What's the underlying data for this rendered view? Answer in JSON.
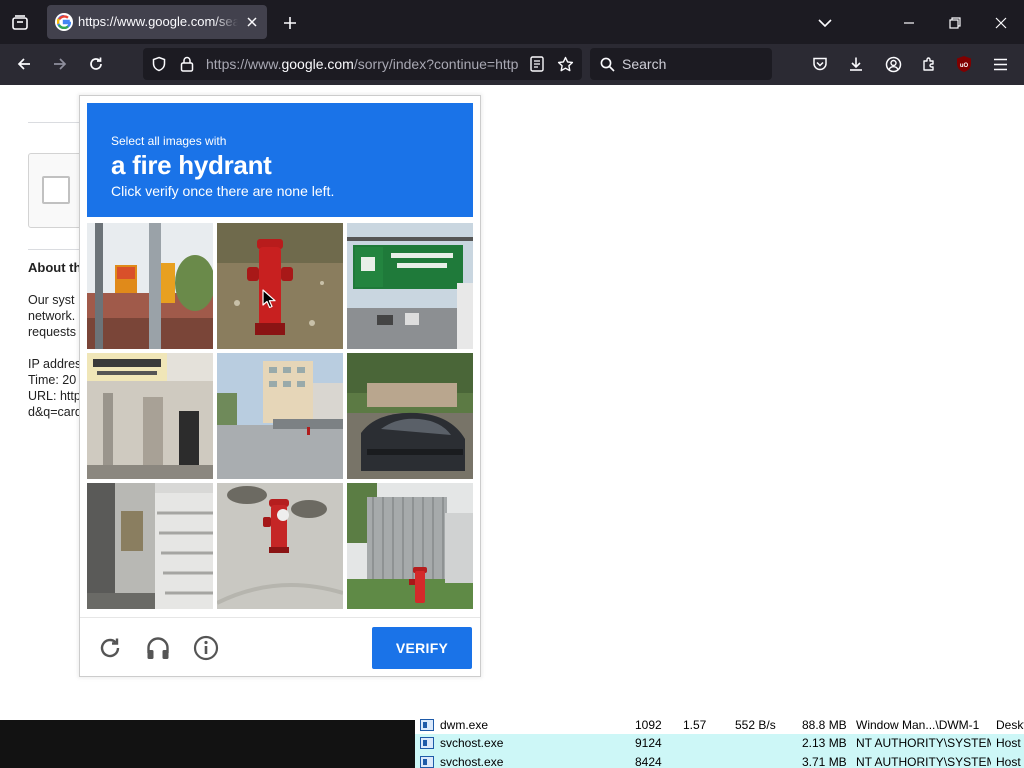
{
  "browser": {
    "tab": {
      "title": "https://www.google.com/sear"
    },
    "url": {
      "prefix": "https://www.",
      "host": "google.com",
      "rest": "/sorry/index?continue=http"
    },
    "search": {
      "placeholder": "Search"
    },
    "icons": [
      "tab-list-icon",
      "google-favicon",
      "close-tab-icon",
      "new-tab-icon",
      "list-all-tabs-icon",
      "minimize-icon",
      "restore-icon",
      "close-window-icon",
      "back-icon",
      "forward-icon",
      "reload-icon",
      "tracking-shield-icon",
      "lock-icon",
      "reader-view-icon",
      "bookmark-star-icon",
      "search-icon",
      "pocket-icon",
      "downloads-icon",
      "account-icon",
      "extensions-icon",
      "ublock-icon",
      "menu-icon"
    ]
  },
  "page": {
    "heading": "About th",
    "para1": [
      "Our syst",
      "network.",
      "requests"
    ],
    "para2": [
      "IP addres",
      "Time: 20",
      "URL: http",
      "d&q=card"
    ]
  },
  "captcha": {
    "instruction": "Select all images with",
    "target": "a fire hydrant",
    "subtext": "Click verify once there are none left.",
    "tiles": [
      "pedestrian-signal-pole",
      "red-fire-hydrant-closeup",
      "highway-overhead-sign",
      "building-entrance-japanese-sign",
      "street-plaza-buildings",
      "parked-car",
      "exterior-staircase",
      "fire-hydrant-on-sidewalk",
      "fire-hydrant-by-fence"
    ],
    "footer_icons": [
      "reload-icon",
      "audio-challenge-icon",
      "info-icon"
    ],
    "verify_label": "VERIFY",
    "colors": {
      "accent": "#1a73e8"
    }
  },
  "task_manager": {
    "rows": [
      {
        "name": "dwm.exe",
        "pid": "1092",
        "cpu": "1.57",
        "io": "552 B/s",
        "mem": "88.8 MB",
        "user": "Window Man...\\DWM-1",
        "extra": "Deskt"
      },
      {
        "name": "svchost.exe",
        "pid": "9124",
        "cpu": "",
        "io": "",
        "mem": "2.13 MB",
        "user": "NT AUTHORITY\\SYSTEM",
        "extra": "Host"
      },
      {
        "name": "svchost.exe",
        "pid": "8424",
        "cpu": "",
        "io": "",
        "mem": "3.71 MB",
        "user": "NT AUTHORITY\\SYSTEM",
        "extra": "Host"
      }
    ]
  }
}
